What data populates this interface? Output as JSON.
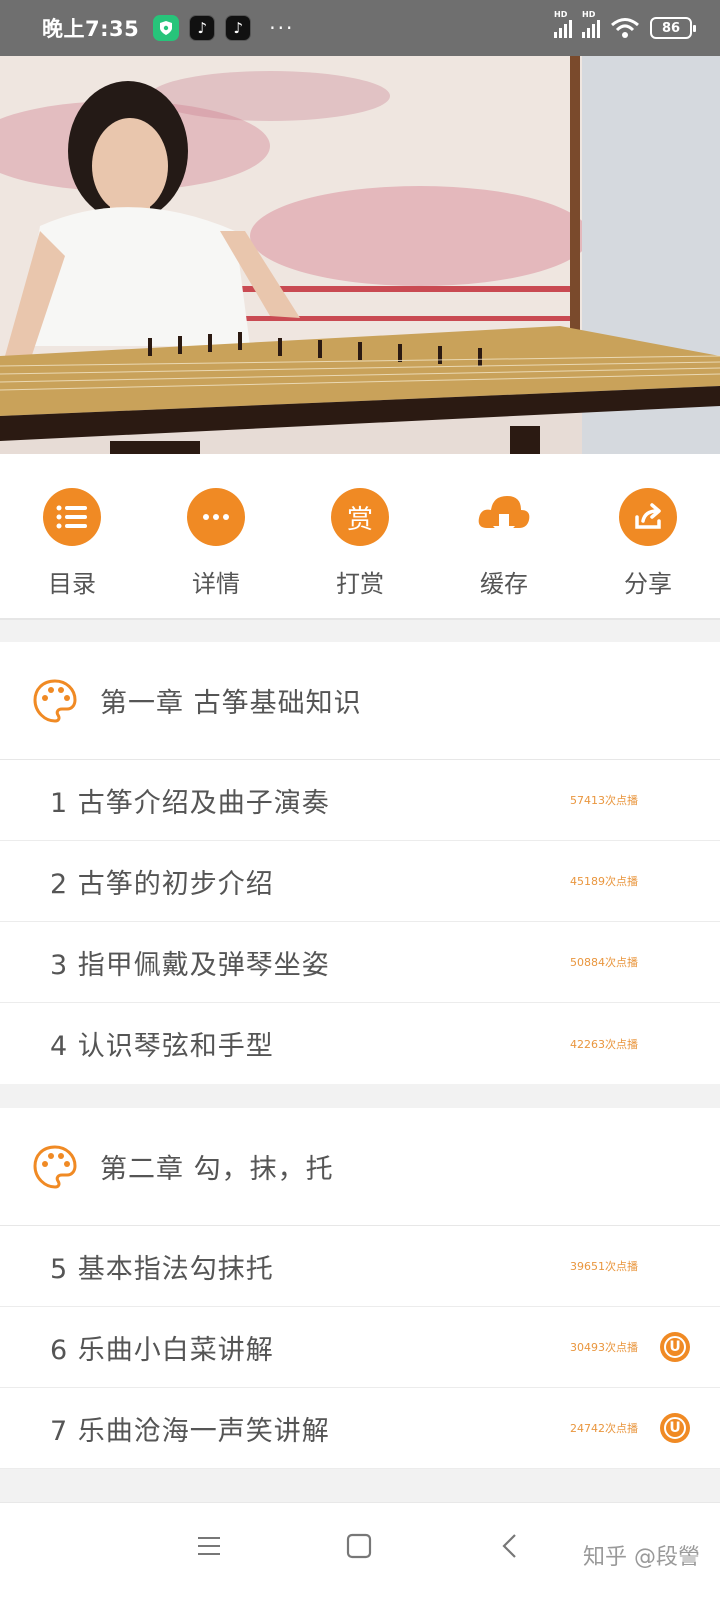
{
  "status_bar": {
    "time": "晚上7:35",
    "more": "···",
    "signal_label_1": "HD",
    "signal_label_2": "HD",
    "battery": "86"
  },
  "toolbar": {
    "items": [
      {
        "label": "目录",
        "icon": "list-icon"
      },
      {
        "label": "详情",
        "icon": "more-dots-icon"
      },
      {
        "label": "打赏",
        "icon": "reward-icon",
        "glyph": "赏"
      },
      {
        "label": "缓存",
        "icon": "cloud-download-icon"
      },
      {
        "label": "分享",
        "icon": "share-icon"
      }
    ]
  },
  "chapters": [
    {
      "title": "第一章 古筝基础知识",
      "lessons": [
        {
          "title": "1 古筝介绍及曲子演奏",
          "plays": "57413次点播"
        },
        {
          "title": "2 古筝的初步介绍",
          "plays": "45189次点播"
        },
        {
          "title": "3 指甲佩戴及弹琴坐姿",
          "plays": "50884次点播"
        },
        {
          "title": "4 认识琴弦和手型",
          "plays": "42263次点播"
        }
      ]
    },
    {
      "title": "第二章  勾，抹，托",
      "lessons": [
        {
          "title": "5 基本指法勾抹托",
          "plays": "39651次点播"
        },
        {
          "title": "6 乐曲小白菜讲解",
          "plays": "30493次点播",
          "badge": "U"
        },
        {
          "title": "7 乐曲沧海一声笑讲解",
          "plays": "24742次点播",
          "badge": "U"
        }
      ]
    }
  ],
  "watermark": "知乎 @段謍",
  "colors": {
    "accent": "#f08a24",
    "play_count": "#e9963e"
  }
}
